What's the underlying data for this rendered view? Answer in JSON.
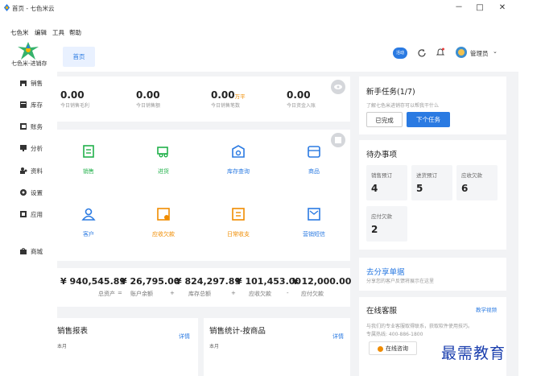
{
  "window": {
    "title": "首页 - 七色米云",
    "minimize": "－",
    "maximize": "□",
    "close": "✕"
  },
  "menu": [
    "七色米",
    "编辑",
    "工具",
    "帮助"
  ],
  "brand": {
    "name": "七色米-进销存"
  },
  "sidebar": [
    {
      "label": "销售",
      "icon": "cart-icon"
    },
    {
      "label": "库存",
      "icon": "warehouse-icon"
    },
    {
      "label": "账务",
      "icon": "ledger-icon"
    },
    {
      "label": "分析",
      "icon": "monitor-icon"
    },
    {
      "label": "资料",
      "icon": "people-icon"
    },
    {
      "label": "设置",
      "icon": "gear-icon"
    },
    {
      "label": "应用",
      "icon": "app-icon"
    },
    {
      "label": "商城",
      "icon": "shop-icon"
    }
  ],
  "tabs": [
    {
      "label": "首页",
      "active": true
    }
  ],
  "header": {
    "badge": "活动",
    "user": "管理员",
    "accent": "#2a7ae2"
  },
  "stats": [
    {
      "value": "0.00",
      "unit": "",
      "label": "今日销售毛利"
    },
    {
      "value": "0.00",
      "unit": "",
      "label": "今日销售额"
    },
    {
      "value": "0.00",
      "unit": "万平",
      "label": "今日销售笔数"
    },
    {
      "value": "0.00",
      "unit": "",
      "label": "今日资金入账"
    }
  ],
  "quick_actions": [
    {
      "label": "销售",
      "icon": "receipt-icon",
      "color": "#21b14a"
    },
    {
      "label": "进货",
      "icon": "truck-icon",
      "color": "#21b14a"
    },
    {
      "label": "库存查询",
      "icon": "inventory-search-icon",
      "color": "#2a7ae2"
    },
    {
      "label": "商品",
      "icon": "box-icon",
      "color": "#2a7ae2"
    },
    {
      "label": "客户",
      "icon": "customer-icon",
      "color": "#2a7ae2"
    },
    {
      "label": "应收欠款",
      "icon": "receivable-icon",
      "color": "#f08c00"
    },
    {
      "label": "日常收支",
      "icon": "expense-icon",
      "color": "#f08c00"
    },
    {
      "label": "营销短信",
      "icon": "sms-icon",
      "color": "#2a7ae2"
    }
  ],
  "finance": {
    "items": [
      {
        "value": "¥ 940,545.89",
        "label": "总资产"
      },
      {
        "value": "¥ 26,795.00",
        "label": "账户余额"
      },
      {
        "value": "¥ 824,297.89",
        "label": "库存总额"
      },
      {
        "value": "¥ 101,453.00",
        "label": "应收欠款"
      },
      {
        "value": "¥ 12,000.00",
        "label": "应付欠款"
      }
    ],
    "operators": [
      "=",
      "+",
      "+",
      "-"
    ]
  },
  "reports": [
    {
      "title": "销售报表",
      "sub": "本月",
      "link": "详情"
    },
    {
      "title": "销售统计-按商品",
      "sub": "本月",
      "link": "详情"
    }
  ],
  "onboarding": {
    "title": "新手任务(1/7)",
    "desc": "了解七色米进销存可以帮我干什么",
    "done_label": "已完成",
    "next_label": "下个任务"
  },
  "todo": {
    "title": "待办事项",
    "items": [
      {
        "label": "销售预订",
        "value": "4"
      },
      {
        "label": "进货预订",
        "value": "5"
      },
      {
        "label": "应收欠款",
        "value": "6"
      },
      {
        "label": "应付欠款",
        "value": "2"
      }
    ]
  },
  "share": {
    "title": "去分享单据",
    "desc": "分享您的客户反馈将展示在这里"
  },
  "service": {
    "title": "在线客服",
    "video_link": "教学视频",
    "desc": "与我们的专业客服取得联系，获取软件使用技巧。",
    "hotline": "专属热线: 400-886-1800",
    "consult_label": "在线咨询"
  },
  "watermark": "最需教育"
}
